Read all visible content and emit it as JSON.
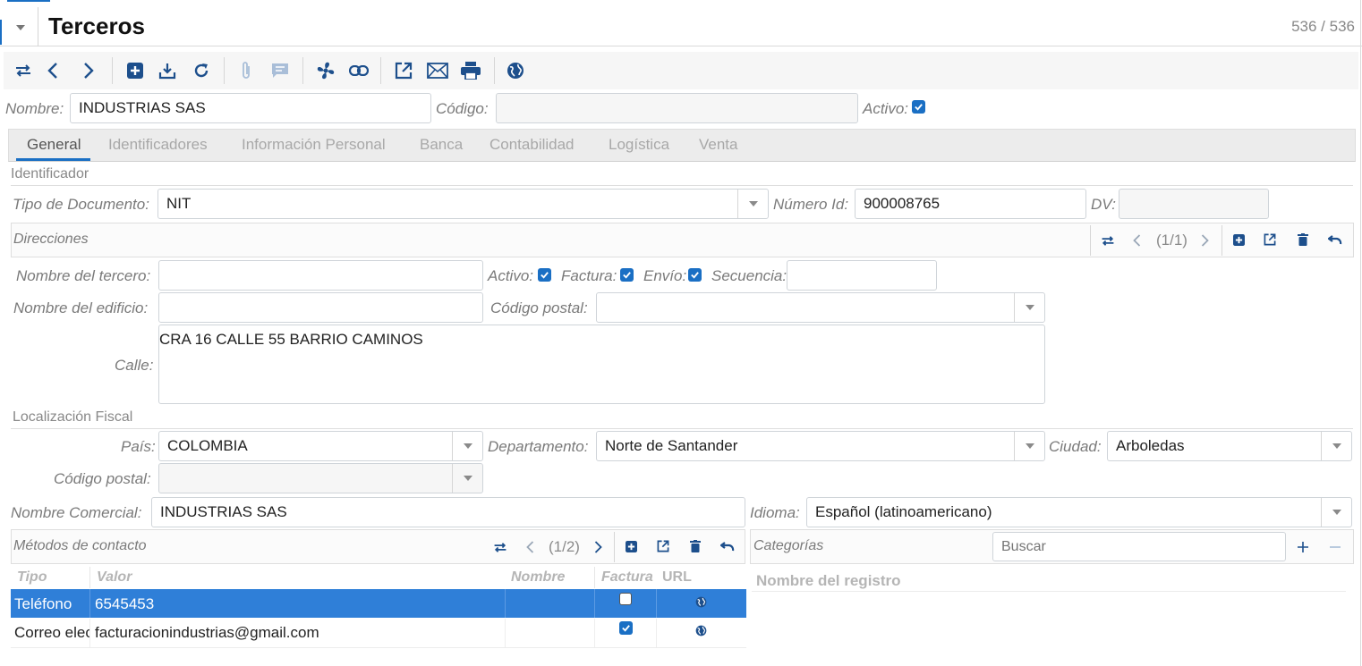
{
  "window": {
    "title": "Terceros",
    "record_counter": "536 / 536"
  },
  "form": {
    "nombre_label": "Nombre:",
    "nombre_value": "INDUSTRIAS SAS",
    "codigo_label": "Código:",
    "codigo_value": "",
    "activo_label": "Activo:"
  },
  "tabs": [
    {
      "label": "General"
    },
    {
      "label": "Identificadores"
    },
    {
      "label": "Información Personal"
    },
    {
      "label": "Banca"
    },
    {
      "label": "Contabilidad"
    },
    {
      "label": "Logística"
    },
    {
      "label": "Venta"
    }
  ],
  "identificador": {
    "section_title": "Identificador",
    "tipo_doc_label": "Tipo de Documento:",
    "tipo_doc_value": "NIT",
    "numero_id_label": "Número Id:",
    "numero_id_value": "900008765",
    "dv_label": "DV:",
    "dv_value": ""
  },
  "direcciones": {
    "title": "Direcciones",
    "pager": "(1/1)",
    "nombre_tercero_label": "Nombre del tercero:",
    "activo_label": "Activo:",
    "factura_label": "Factura:",
    "envio_label": "Envío:",
    "secuencia_label": "Secuencia:",
    "nombre_edificio_label": "Nombre del edificio:",
    "codigo_postal_label": "Código postal:",
    "calle_label": "Calle:",
    "calle_value": "CRA 16 CALLE 55 BARRIO CAMINOS",
    "loc_fiscal_title": "Localización Fiscal",
    "pais_label": "País:",
    "pais_value": "COLOMBIA",
    "departamento_label": "Departamento:",
    "departamento_value": "Norte de Santander",
    "ciudad_label": "Ciudad:",
    "ciudad_value": "Arboledas",
    "codigo_postal2_label": "Código postal:"
  },
  "comercial": {
    "nombre_comercial_label": "Nombre Comercial:",
    "nombre_comercial_value": "INDUSTRIAS SAS",
    "idioma_label": "Idioma:",
    "idioma_value": "Español (latinoamericano)"
  },
  "contactos": {
    "title": "Métodos de contacto",
    "pager": "(1/2)",
    "columns": [
      "Tipo",
      "Valor",
      "Nombre",
      "Factura",
      "URL"
    ],
    "rows": [
      {
        "tipo": "Teléfono",
        "valor": "6545453",
        "nombre": "",
        "factura": false
      },
      {
        "tipo": "Correo electrónico",
        "valor": "facturacionindustrias@gmail.com",
        "nombre": "",
        "factura": true
      }
    ]
  },
  "categorias": {
    "title": "Categorías",
    "search_placeholder": "Buscar",
    "column": "Nombre del registro"
  },
  "colors": {
    "accent": "#1a6fc4",
    "selected_row": "#2f7fd8"
  }
}
